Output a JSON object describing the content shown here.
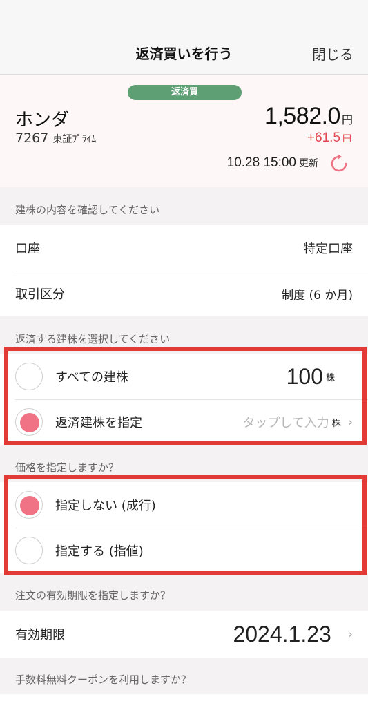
{
  "header": {
    "title": "返済買いを行う",
    "close": "閉じる"
  },
  "stock": {
    "badge": "返済買",
    "name": "ホンダ",
    "code": "7267",
    "exchange": "東証ﾌﾟﾗｲﾑ",
    "price": "1,582.0",
    "price_unit": "円",
    "change": "+61.5",
    "change_unit": "円",
    "updated_time": "10.28 15:00",
    "updated_label": "更新",
    "change_color": "#e0474e"
  },
  "position_section": {
    "label": "建株の内容を確認してください",
    "account_label": "口座",
    "account_value": "特定口座",
    "type_label": "取引区分",
    "type_value": "制度 (6 か月)"
  },
  "select_section": {
    "label": "返済する建株を選択してください",
    "all_label": "すべての建株",
    "all_qty": "100",
    "all_unit": "株",
    "specify_label": "返済建株を指定",
    "specify_placeholder": "タップして入力",
    "specify_unit": "株",
    "selected": "specify"
  },
  "price_section": {
    "label": "価格を指定しますか？",
    "market_label": "指定しない (成行)",
    "limit_label": "指定する (指値)",
    "selected": "market"
  },
  "expiry_section": {
    "label": "注文の有効期限を指定しますか？",
    "expiry_label": "有効期限",
    "expiry_value": "2024.1.23"
  },
  "coupon_section": {
    "label": "手数料無料クーポンを利用しますか？"
  },
  "colors": {
    "accent": "#ef7384",
    "badge": "#5e9f73",
    "highlight": "#e23b36"
  }
}
